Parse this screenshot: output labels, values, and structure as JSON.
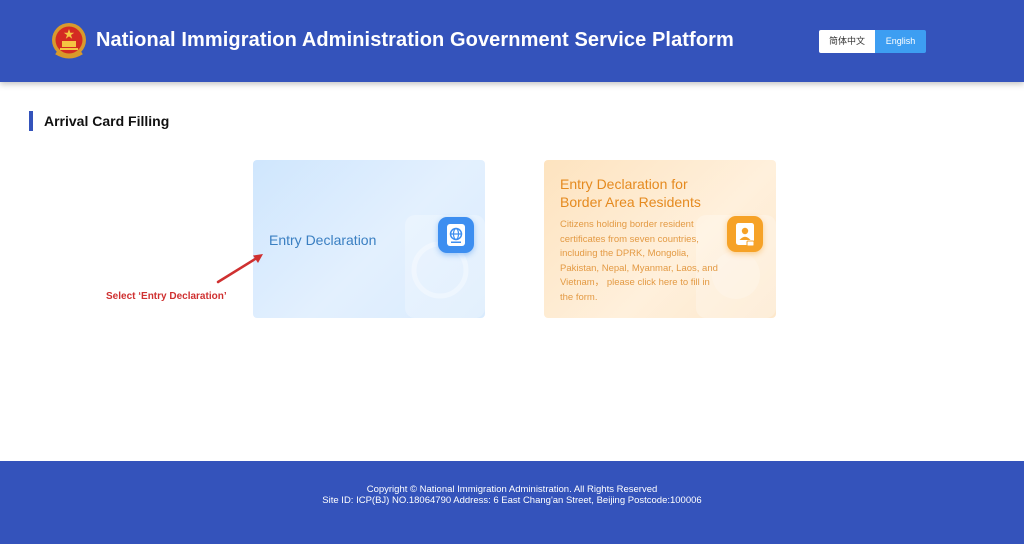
{
  "header": {
    "title": "National Immigration Administration Government Service Platform",
    "emblem_icon": "national-emblem-icon",
    "languages": {
      "chinese": "简体中文",
      "english": "English",
      "selected": "English"
    }
  },
  "section": {
    "title": "Arrival Card Filling"
  },
  "cards": {
    "entry": {
      "label": "Entry Declaration",
      "icon": "passport-globe-icon"
    },
    "border": {
      "title": "Entry Declaration for Border Area Residents",
      "description": "Citizens holding border resident certificates from seven countries, including the DPRK, Mongolia, Pakistan, Nepal, Myanmar, Laos, and Vietnam， please click here to fill in the form.",
      "icon": "id-card-icon"
    }
  },
  "annotation": {
    "text": "Select ‘Entry Declaration’"
  },
  "footer": {
    "copyright": "Copyright © National Immigration Administration. All Rights Reserved",
    "site_info": "Site ID: ICP(BJ) NO.18064790 Address: 6 East Chang'an Street, Beijing Postcode:100006"
  },
  "colors": {
    "brand_blue": "#3453bb",
    "active_lang": "#3d9ef2",
    "entry_accent": "#3a7fc2",
    "border_accent": "#e58a1f",
    "annotation_red": "#cf3030"
  }
}
